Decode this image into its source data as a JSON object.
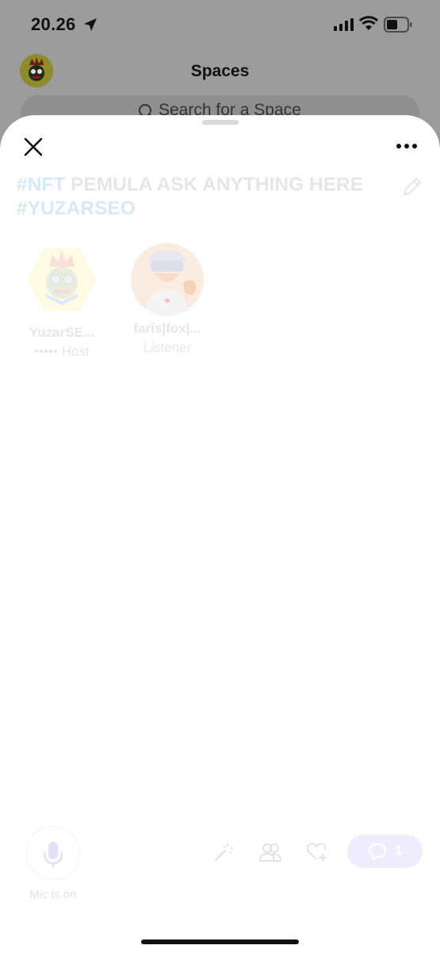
{
  "status_bar": {
    "time": "20.26"
  },
  "background": {
    "title": "Spaces",
    "search_placeholder": "Search for a Space"
  },
  "space": {
    "title_tag1": "#NFT",
    "title_main": "PEMULA ASK ANYTHING HERE",
    "title_tag2": "#YUZARSEO"
  },
  "participants": [
    {
      "name": "YuzarSE...",
      "role": "Host",
      "role_prefix": "•••••"
    },
    {
      "name": "faris|fox|...",
      "role": "Listener"
    }
  ],
  "controls": {
    "mic_label": "Mic is on",
    "chat_count": "1"
  },
  "colors": {
    "tag_blue": "#d8e9f6",
    "chat_bg": "#efecfd",
    "sheet": "#ffffff"
  }
}
